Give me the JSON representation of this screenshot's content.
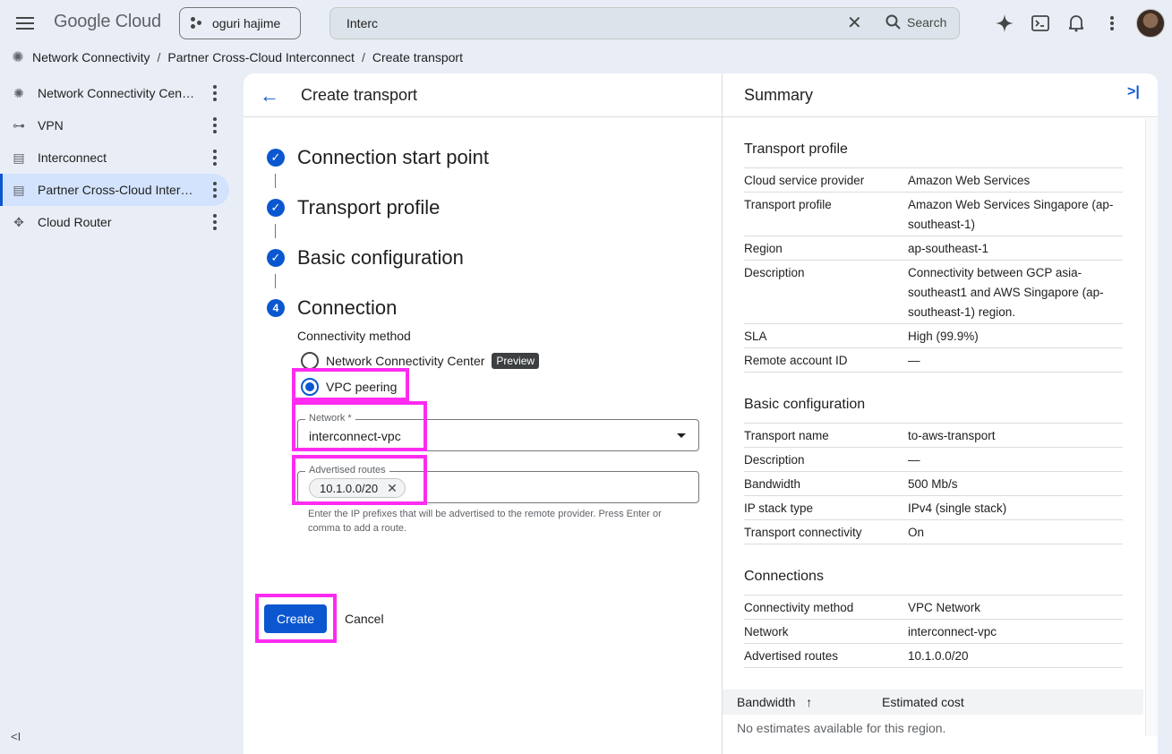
{
  "header": {
    "logo": "Google Cloud",
    "project": "oguri hajime",
    "search_value": "Interc",
    "search_button": "Search"
  },
  "breadcrumb": [
    "Network Connectivity",
    "Partner Cross-Cloud Interconnect",
    "Create transport"
  ],
  "sidebar": {
    "items": [
      {
        "label": "Network Connectivity Center",
        "icon": "hub-icon"
      },
      {
        "label": "VPN",
        "icon": "vpn-icon"
      },
      {
        "label": "Interconnect",
        "icon": "interconnect-icon"
      },
      {
        "label": "Partner Cross-Cloud Interconnect",
        "icon": "interconnect-icon"
      },
      {
        "label": "Cloud Router",
        "icon": "router-icon"
      }
    ]
  },
  "main": {
    "title": "Create transport",
    "steps": [
      {
        "title": "Connection start point",
        "state": "done"
      },
      {
        "title": "Transport profile",
        "state": "done"
      },
      {
        "title": "Basic configuration",
        "state": "done"
      },
      {
        "title": "Connection",
        "state": "active",
        "number": "4"
      }
    ],
    "connectivity_method_label": "Connectivity method",
    "radio_ncc": "Network Connectivity Center",
    "preview_badge": "Preview",
    "radio_vpc": "VPC peering",
    "network_label": "Network *",
    "network_value": "interconnect-vpc",
    "routes_label": "Advertised routes",
    "route_chip": "10.1.0.0/20",
    "routes_helper": "Enter the IP prefixes that will be advertised to the remote provider. Press Enter or comma to add a route.",
    "create": "Create",
    "cancel": "Cancel"
  },
  "summary": {
    "title": "Summary",
    "transport_profile": {
      "heading": "Transport profile",
      "rows": [
        {
          "k": "Cloud service provider",
          "v": "Amazon Web Services"
        },
        {
          "k": "Transport profile",
          "v": "Amazon Web Services Singapore (ap-southeast-1)"
        },
        {
          "k": "Region",
          "v": "ap-southeast-1"
        },
        {
          "k": "Description",
          "v": "Connectivity between GCP asia-southeast1 and AWS Singapore (ap-southeast-1) region."
        },
        {
          "k": "SLA",
          "v": "High (99.9%)"
        },
        {
          "k": "Remote account ID",
          "v": "—"
        }
      ]
    },
    "basic_configuration": {
      "heading": "Basic configuration",
      "rows": [
        {
          "k": "Transport name",
          "v": "to-aws-transport"
        },
        {
          "k": "Description",
          "v": "—"
        },
        {
          "k": "Bandwidth",
          "v": "500 Mb/s"
        },
        {
          "k": "IP stack type",
          "v": "IPv4 (single stack)"
        },
        {
          "k": "Transport connectivity",
          "v": "On"
        }
      ]
    },
    "connections": {
      "heading": "Connections",
      "rows": [
        {
          "k": "Connectivity method",
          "v": "VPC Network"
        },
        {
          "k": "Network",
          "v": "interconnect-vpc"
        },
        {
          "k": "Advertised routes",
          "v": "10.1.0.0/20"
        }
      ]
    },
    "cost_table": {
      "col1": "Bandwidth",
      "col2": "Estimated cost",
      "empty": "No estimates available for this region."
    }
  },
  "colors": {
    "accent": "#0b57d0",
    "highlight": "#ff2bf0"
  }
}
